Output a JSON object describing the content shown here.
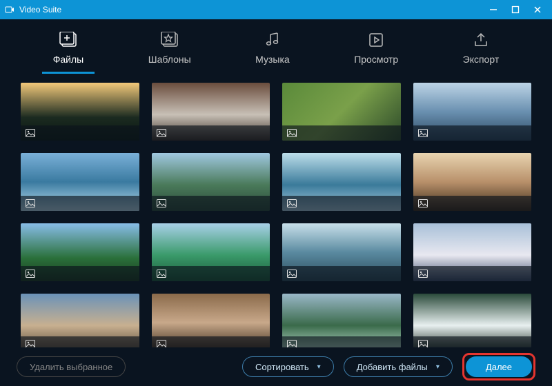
{
  "titlebar": {
    "app_name": "Video Suite"
  },
  "tabs": [
    {
      "label": "Файлы",
      "icon": "add-folder",
      "active": true
    },
    {
      "label": "Шаблоны",
      "icon": "star-collection",
      "active": false
    },
    {
      "label": "Музыка",
      "icon": "music-note",
      "active": false
    },
    {
      "label": "Просмотр",
      "icon": "play-square",
      "active": false
    },
    {
      "label": "Экспорт",
      "icon": "export-up",
      "active": false
    }
  ],
  "thumbnails": [
    {
      "id": 1,
      "type": "image"
    },
    {
      "id": 2,
      "type": "image"
    },
    {
      "id": 3,
      "type": "image"
    },
    {
      "id": 4,
      "type": "image"
    },
    {
      "id": 5,
      "type": "image"
    },
    {
      "id": 6,
      "type": "image"
    },
    {
      "id": 7,
      "type": "image"
    },
    {
      "id": 8,
      "type": "image"
    },
    {
      "id": 9,
      "type": "image"
    },
    {
      "id": 10,
      "type": "image"
    },
    {
      "id": 11,
      "type": "image"
    },
    {
      "id": 12,
      "type": "image"
    },
    {
      "id": 13,
      "type": "image"
    },
    {
      "id": 14,
      "type": "image"
    },
    {
      "id": 15,
      "type": "image"
    },
    {
      "id": 16,
      "type": "image"
    }
  ],
  "bottombar": {
    "delete_label": "Удалить выбранное",
    "sort_label": "Сортировать",
    "add_label": "Добавить файлы",
    "next_label": "Далее"
  },
  "colors": {
    "accent": "#0d94d6",
    "highlight": "#e5352f",
    "bg_dark": "#0a1420"
  }
}
